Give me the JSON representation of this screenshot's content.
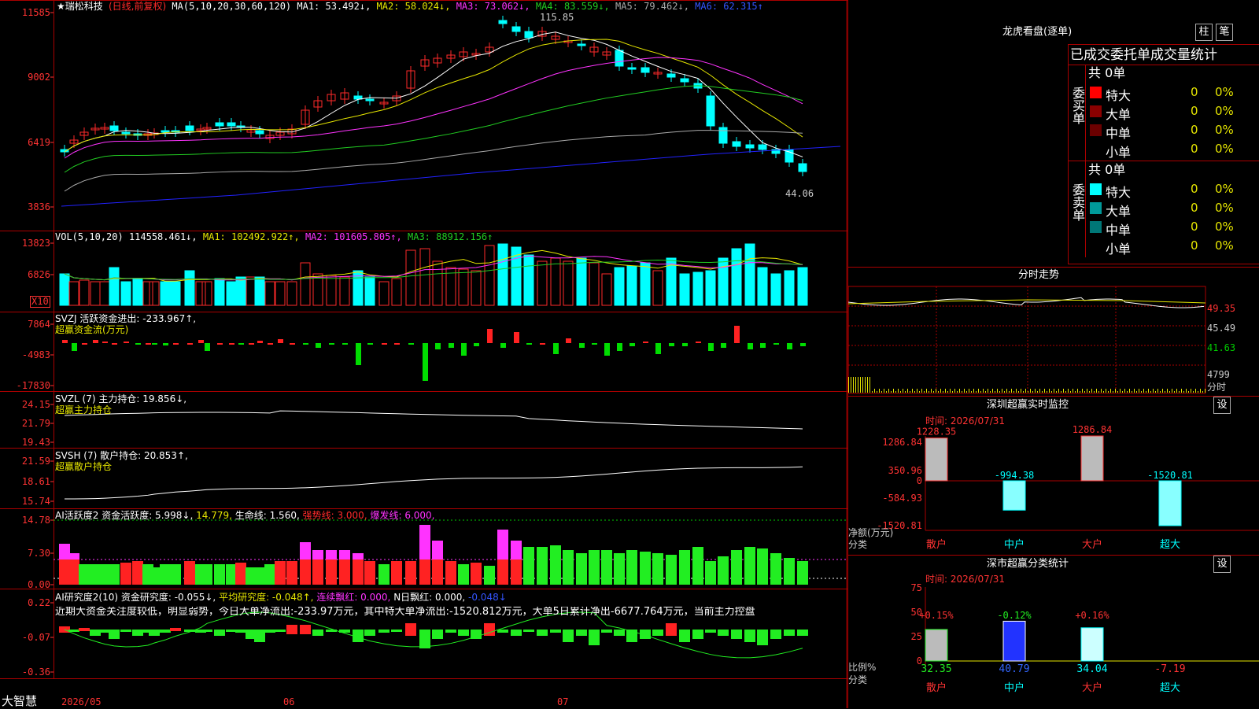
{
  "colors": {
    "up": "#ff2a2a",
    "down": "#00ffff",
    "ma1": "#ffffff",
    "ma2": "#e6e600",
    "ma3": "#ff33ff",
    "ma4": "#22cc22",
    "ma5": "#aaaaaa",
    "ma6": "#2222ff",
    "green": "#00ee00"
  },
  "main": {
    "stock_name": "★瑞松科技",
    "period": "(日线,前复权)",
    "ma_label": "MA(5,10,20,30,60,120)",
    "ma1": "MA1: 53.492↓,",
    "ma2": "MA2: 58.024↓,",
    "ma3": "MA3: 73.062↓,",
    "ma4": "MA4: 83.559↓,",
    "ma5": "MA5: 79.462↓,",
    "ma6": "MA6: 62.315↑",
    "yticks": [
      "11585",
      "9002",
      "6419",
      "3836"
    ],
    "high_label": "115.85",
    "low_label": "44.06"
  },
  "vol": {
    "label": "VOL(5,10,20)",
    "val": "114558.461↓,",
    "ma1": "MA1: 102492.922↑,",
    "ma2": "MA2: 101605.805↑,",
    "ma3": "MA3: 88912.156↑",
    "yticks": [
      "13823",
      "6826"
    ],
    "unit": "X10"
  },
  "svzj": {
    "label": "SVZJ  活跃资金进出: -233.967↑,",
    "sub": "超赢资金流(万元)",
    "yticks": [
      "7864",
      "-4983",
      "-17830"
    ]
  },
  "svzl": {
    "label": "SVZL (7) 主力持仓: 19.856↓,",
    "sub": "超赢主力持仓",
    "yticks": [
      "24.15",
      "21.79",
      "19.43"
    ]
  },
  "svsh": {
    "label": "SVSH (7) 散户持仓: 20.853↑,",
    "sub": "超赢散户持仓",
    "yticks": [
      "21.59",
      "18.61",
      "15.74"
    ]
  },
  "ai1": {
    "label": "AI活跃度2 资金活跃度: 5.998↓,",
    "v2": "14.779,",
    "v3": "生命线: 1.560,",
    "v4": "强势线: 3.000,",
    "v5": "爆发线: 6.000,",
    "yticks": [
      "14.78",
      "7.30",
      "0.00"
    ]
  },
  "ai2": {
    "label": "AI研究度2(10) 资金研究度: -0.055↓,",
    "v2": "平均研究度: -0.048↑,",
    "v3": "连续飘红: 0.000,",
    "v4": "N日飘红: 0.000,",
    "v5": "-0.048↓",
    "note": "近期大资金关注度较低，明显弱势，今日大单净流出:-233.97万元，其中特大单净流出:-1520.812万元，大单5日累计净出-6677.764万元，当前主力控盘",
    "yticks": [
      "0.22",
      "-0.07",
      "-0.36"
    ]
  },
  "bottom": {
    "brand": "大智慧",
    "d1": "2026/05",
    "d2": "06",
    "d3": "07"
  },
  "lhb": {
    "title": "龙虎看盘(逐单)",
    "btn1": "柱",
    "btn2": "笔",
    "header": "已成交委托单成交量统计",
    "buy": {
      "side": "委买单",
      "total": "共 0单",
      "rows": [
        {
          "name": "特大",
          "v": "0",
          "p": "0%"
        },
        {
          "name": "大单",
          "v": "0",
          "p": "0%"
        },
        {
          "name": "中单",
          "v": "0",
          "p": "0%"
        },
        {
          "name": "小单",
          "v": "0",
          "p": "0%"
        }
      ]
    },
    "sell": {
      "side": "委卖单",
      "total": "共 0单",
      "rows": [
        {
          "name": "特大",
          "v": "0",
          "p": "0%"
        },
        {
          "name": "大单",
          "v": "0",
          "p": "0%"
        },
        {
          "name": "中单",
          "v": "0",
          "p": "0%"
        },
        {
          "name": "小单",
          "v": "0",
          "p": "0%"
        }
      ]
    }
  },
  "fenshi": {
    "title": "分时走势",
    "yticks": [
      "49.35",
      "45.49",
      "41.63",
      "4799"
    ],
    "xlabel": "分时"
  },
  "monitor": {
    "title": "深圳超赢实时监控",
    "btn": "设",
    "time": "时间: 2026/07/31",
    "yticks": [
      "1286.84",
      "350.96",
      "0",
      "-584.93",
      "-1520.81"
    ],
    "ylabel": "净额(万元)",
    "xlabel": "分类",
    "cats": [
      "散户",
      "中户",
      "大户",
      "超大"
    ],
    "values": [
      "1228.35",
      "-994.38",
      "1286.84",
      "-1520.81"
    ]
  },
  "classify": {
    "title": "深市超赢分类统计",
    "btn": "设",
    "time": "时间: 2026/07/31",
    "yticks": [
      "75",
      "50",
      "25",
      "0"
    ],
    "ylabel": "比例%",
    "xlabel": "分类",
    "cats": [
      "散户",
      "中户",
      "大户",
      "超大"
    ],
    "top": [
      "+0.15%",
      "-0.12%",
      "+0.16%",
      ""
    ],
    "bottom": [
      "32.35",
      "40.79",
      "34.04",
      "-7.19"
    ]
  }
}
